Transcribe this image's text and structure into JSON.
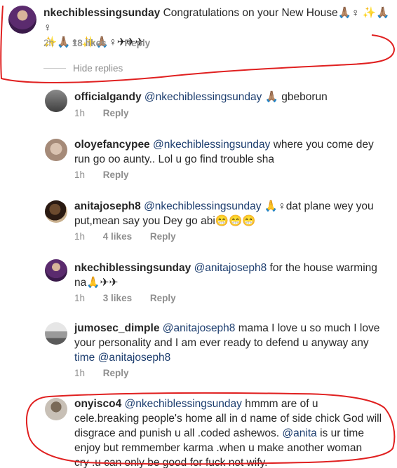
{
  "main_comment": {
    "username": "nkechiblessingsunday",
    "text": "Congratulations on your New House🙏🏽♀ ✨🙏🏽♀",
    "text_line2": "✨🙏🏽♀ ✨🙏🏽♀✈✈✈",
    "time": "2h",
    "likes": "18 likes",
    "reply": "Reply"
  },
  "hide_replies": "Hide replies",
  "replies": [
    {
      "username": "officialgandy",
      "mention": "@nkechiblessingsunday",
      "text": "🙏🏽 gbeborun",
      "time": "1h",
      "likes": "",
      "reply": "Reply"
    },
    {
      "username": "oloyefancypee",
      "mention": "@nkechiblessingsunday",
      "text": "where you come dey",
      "text2": "run go oo aunty.. Lol u go find trouble sha",
      "time": "1h",
      "likes": "",
      "reply": "Reply"
    },
    {
      "username": "anitajoseph8",
      "mention": "@nkechiblessingsunday",
      "text": "🙏♀dat plane wey you",
      "text2": "put,mean say you Dey go abi😁😁😁",
      "time": "1h",
      "likes": "4 likes",
      "reply": "Reply"
    },
    {
      "username": "nkechiblessingsunday",
      "mention": "@anitajoseph8",
      "text": "for the house warming",
      "text2": "na🙏✈✈",
      "time": "1h",
      "likes": "3 likes",
      "reply": "Reply"
    },
    {
      "username": "jumosec_dimple",
      "mention": "@anitajoseph8",
      "text": "mama I love u so much I love",
      "text2": "your personality and I am ever ready to defend u anyway any",
      "text3_mention": "time @anitajoseph8",
      "time": "1h",
      "likes": "",
      "reply": "Reply"
    },
    {
      "username": "onyisco4",
      "mention": "@nkechiblessingsunday",
      "text": "hmmm are of u",
      "text2": "cele.breaking people's home all in d name of side chick God will",
      "text3": "disgrace and punish u all .coded ashewos.",
      "text3_mention": "@anita",
      "text3_tail": " is ur time",
      "text4": "enjoy but remmember karma .when u make another woman",
      "text5": "cry .u can only be good for fuck not wify."
    }
  ],
  "colors": {
    "text": "#262626",
    "meta": "#8e8e8e",
    "mention": "#1c3d6e",
    "annotation": "#e02020"
  }
}
